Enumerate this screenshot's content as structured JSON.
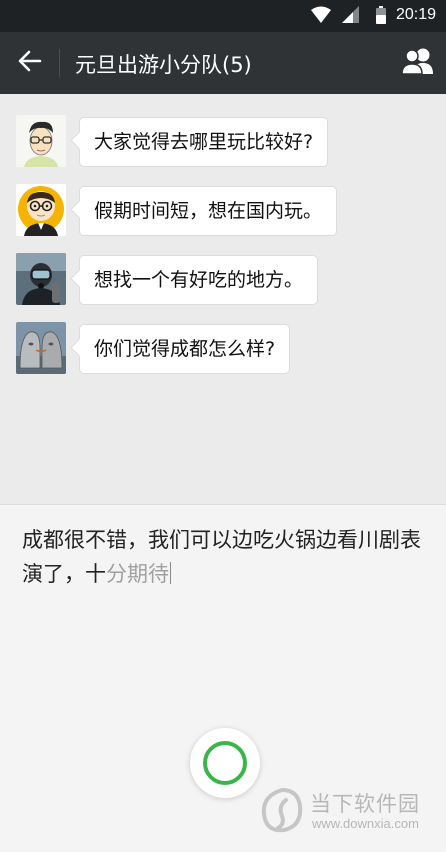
{
  "status_bar": {
    "time": "20:19",
    "icons": [
      "wifi-icon",
      "signal-icon",
      "battery-icon"
    ]
  },
  "header": {
    "back_icon": "arrow-left-icon",
    "title": "元旦出游小分队(5)",
    "group_icon": "group-members-icon"
  },
  "messages": [
    {
      "avatar": "avatar-glasses-sketch",
      "text": "大家觉得去哪里玩比较好?"
    },
    {
      "avatar": "avatar-cartoon-bald",
      "text": "假期时间短，想在国内玩。"
    },
    {
      "avatar": "avatar-diver-photo",
      "text": "想找一个有好吃的地方。"
    },
    {
      "avatar": "avatar-metal-heads-photo",
      "text": "你们觉得成都怎么样?"
    }
  ],
  "input": {
    "committed_text": "成都很不错，我们可以边吃火锅边看川剧表演了，十",
    "pending_text": "分期待"
  },
  "voice_button": {
    "icon": "voice-record-icon"
  },
  "watermark": {
    "brand": "当下软件园",
    "url": "www.downxia.com"
  },
  "colors": {
    "status_bar": "#1f2224",
    "title_bar": "#2f3335",
    "chat_background": "#ebebeb",
    "input_background": "#f4f4f4",
    "accent_green": "#39b54a"
  }
}
